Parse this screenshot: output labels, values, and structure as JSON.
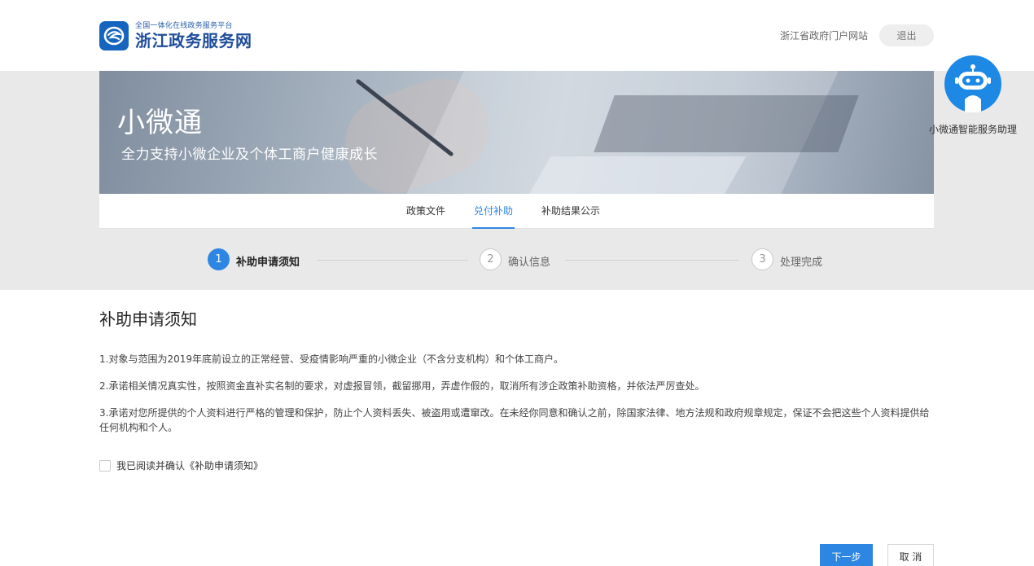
{
  "header": {
    "logo_subtitle": "全国一体化在线政务服务平台",
    "logo_title": "浙江政务服务网",
    "portal_link": "浙江省政府门户网站",
    "logout_label": "退出"
  },
  "banner": {
    "title": "小微通",
    "subtitle": "全力支持小微企业及个体工商户健康成长"
  },
  "assistant": {
    "label": "小微通智能服务助理",
    "icon": "robot-icon"
  },
  "tabs": [
    {
      "label": "政策文件",
      "active": false
    },
    {
      "label": "兑付补助",
      "active": true
    },
    {
      "label": "补助结果公示",
      "active": false
    }
  ],
  "steps": [
    {
      "number": "1",
      "label": "补助申请须知",
      "active": true
    },
    {
      "number": "2",
      "label": "确认信息",
      "active": false
    },
    {
      "number": "3",
      "label": "处理完成",
      "active": false
    }
  ],
  "content": {
    "title": "补助申请须知",
    "notices": [
      "1.对象与范围为2019年底前设立的正常经营、受疫情影响严重的小微企业（不含分支机构）和个体工商户。",
      "2.承诺相关情况真实性，按照资金直补实名制的要求，对虚报冒领，截留挪用，弄虚作假的，取消所有涉企政策补助资格，并依法严厉查处。",
      "3.承诺对您所提供的个人资料进行严格的管理和保护，防止个人资料丢失、被盗用或遭窜改。在未经你同意和确认之前，除国家法律、地方法规和政府规章规定，保证不会把这些个人资料提供给任何机构和个人。"
    ],
    "agree_label": "我已阅读并确认《补助申请须知》",
    "agree_checked": false
  },
  "actions": {
    "next_label": "下一步",
    "cancel_label": "取 消"
  },
  "colors": {
    "accent": "#2d87e2",
    "brand": "#1f4d9a",
    "band": "#e9e9e9"
  }
}
